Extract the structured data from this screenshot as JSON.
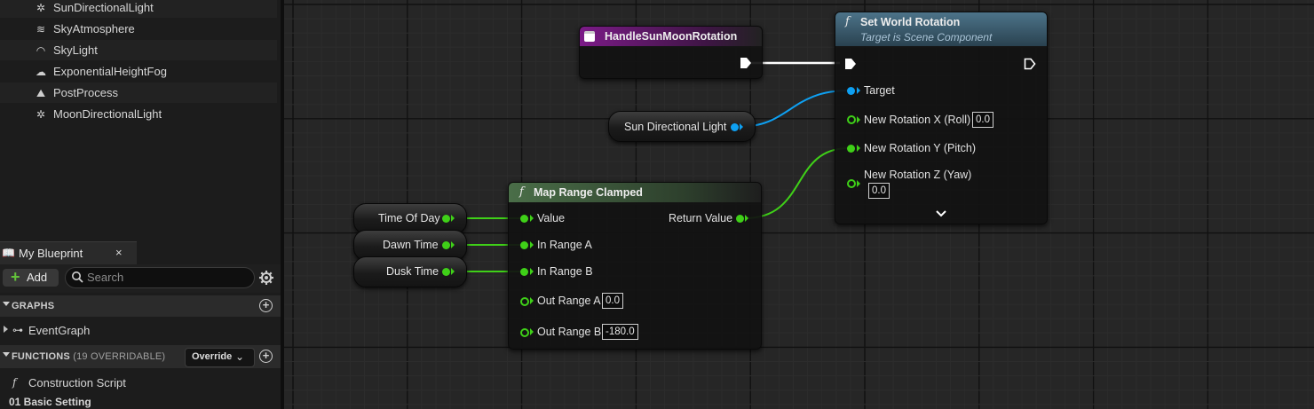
{
  "components": [
    {
      "label": "SunDirectionalLight",
      "icon": "directional-light-icon"
    },
    {
      "label": "SkyAtmosphere",
      "icon": "sky-atmosphere-icon"
    },
    {
      "label": "SkyLight",
      "icon": "sky-light-icon"
    },
    {
      "label": "ExponentialHeightFog",
      "icon": "fog-icon"
    },
    {
      "label": "PostProcess",
      "icon": "post-process-icon"
    },
    {
      "label": "MoonDirectionalLight",
      "icon": "directional-light-icon"
    }
  ],
  "my_blueprint": {
    "tab_label": "My Blueprint",
    "close": "×",
    "add_label": "Add",
    "search_placeholder": "Search",
    "graphs_label": "GRAPHS",
    "event_graph": "EventGraph",
    "functions_label": "FUNCTIONS",
    "functions_sub": "(19 OVERRIDABLE)",
    "override_label": "Override",
    "construction_script": "Construction Script",
    "basic_setting": "01 Basic Setting"
  },
  "nodes": {
    "handle_event": {
      "title": "HandleSunMoonRotation"
    },
    "set_world_rotation": {
      "title": "Set World Rotation",
      "subtitle": "Target is Scene Component",
      "pins": {
        "target": "Target",
        "rot_x": "New Rotation X (Roll)",
        "rot_x_value": "0.0",
        "rot_y": "New Rotation Y (Pitch)",
        "rot_z": "New Rotation Z (Yaw)",
        "rot_z_value": "0.0"
      }
    },
    "sun_var": {
      "label": "Sun Directional Light"
    },
    "time_of_day": {
      "label": "Time Of Day"
    },
    "dawn_time": {
      "label": "Dawn Time"
    },
    "dusk_time": {
      "label": "Dusk Time"
    },
    "map_range": {
      "title": "Map Range Clamped",
      "pins": {
        "value": "Value",
        "return_value": "Return Value",
        "in_range_a": "In Range A",
        "in_range_b": "In Range B",
        "out_range_a": "Out Range A",
        "out_range_a_value": "0.0",
        "out_range_b": "Out Range B",
        "out_range_b_value": "-180.0"
      }
    }
  },
  "colors": {
    "float_pin": "#3fd018",
    "object_pin": "#0ea0f2",
    "event_header": "#7a1b86",
    "function_header": "#3a5a6e",
    "pure_function_header": "#3f5a3a"
  }
}
